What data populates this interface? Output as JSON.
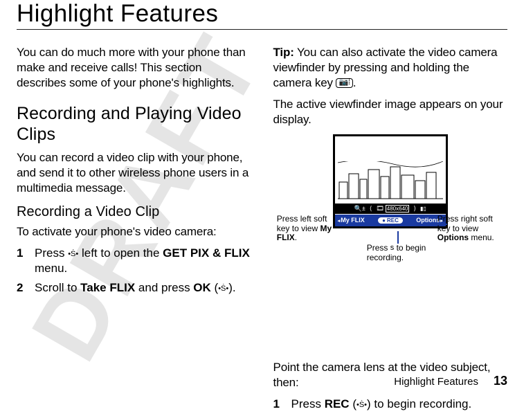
{
  "page": {
    "title": "Highlight Features",
    "watermark": "DRAFT",
    "footer_title": "Highlight Features",
    "page_number": "13"
  },
  "left": {
    "intro": "You can do much more with your phone than make and receive calls! This section describes some of your phone's highlights.",
    "h2": "Recording and Playing Video Clips",
    "p1": "You can record a video clip with your phone, and send it to other wireless phone users in a multimedia message.",
    "h3": "Recording a Video Clip",
    "p2": "To activate your phone's video camera:",
    "step1_pre": "Press ",
    "step1_post_a": " left to open the ",
    "step1_menu": "GET PIX & FLIX",
    "step1_post_b": " menu.",
    "step2_pre": "Scroll to ",
    "step2_bold": "Take FLIX",
    "step2_mid": " and press ",
    "step2_ok": "OK",
    "step2_post": " (",
    "step2_close": ")."
  },
  "right": {
    "tip_label": "Tip:",
    "tip_text_a": " You can also activate the video camera viewfinder by pressing and holding the camera key ",
    "tip_text_b": ".",
    "p_viewfinder": "The active viewfinder image appears on your display.",
    "point": "Point the camera lens at the video subject, then:",
    "step1_pre": "Press ",
    "step1_rec": "REC",
    "step1_mid": " (",
    "step1_post": ") to begin recording."
  },
  "diagram": {
    "resolution": "480x640",
    "soft_left": "My FLIX",
    "soft_center": "REC",
    "soft_right": "Options",
    "callout_left_a": "Press left soft key to view ",
    "callout_left_b": "My FLIX",
    "callout_left_c": ".",
    "callout_right_a": "Press right soft key to view ",
    "callout_right_b": "Options",
    "callout_right_c": " menu.",
    "callout_bottom_a": "Press ",
    "callout_bottom_b": " to begin recording."
  },
  "icons": {
    "nav_key": "•Ṡ•",
    "center_key": "s",
    "camera": "📷⁞"
  }
}
